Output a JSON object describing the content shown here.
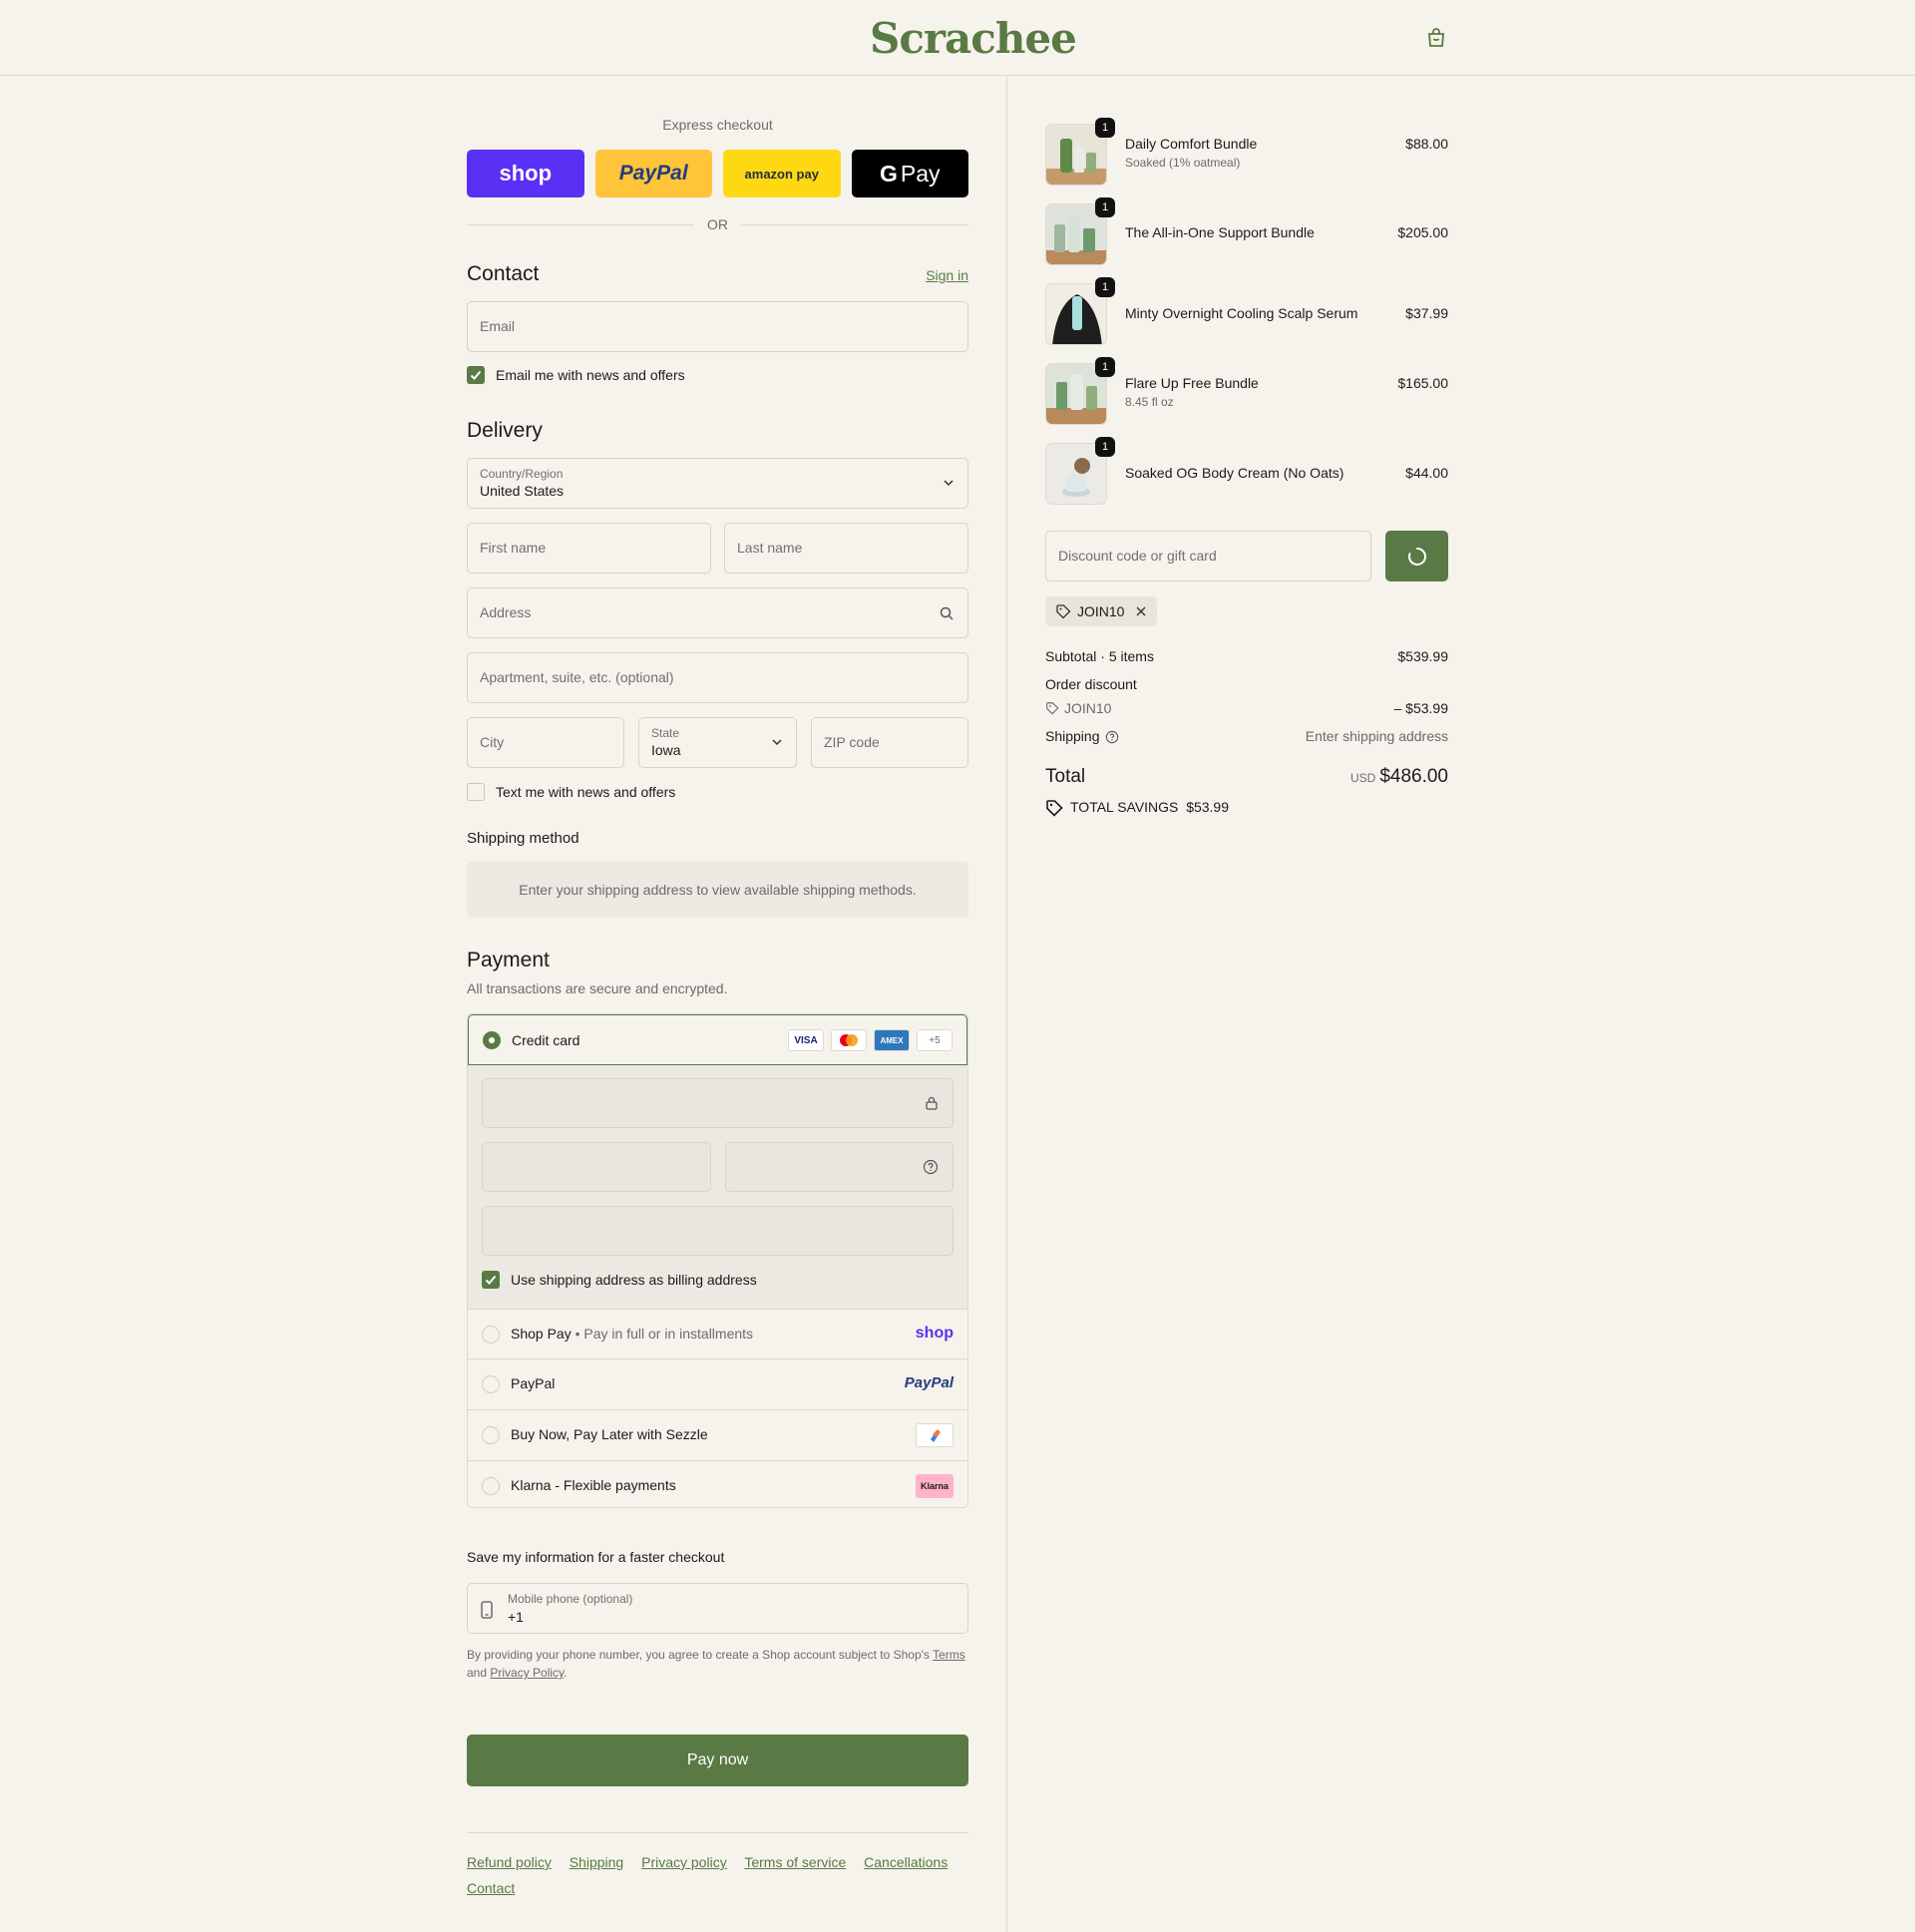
{
  "brand": {
    "logo_text": "Scrachee",
    "accent": "#5a7a45"
  },
  "header": {
    "cart_icon": "shopping-bag-icon"
  },
  "express": {
    "title": "Express checkout",
    "buttons": [
      "shop",
      "PayPal",
      "amazon pay",
      "Pay"
    ],
    "or": "OR"
  },
  "contact": {
    "title": "Contact",
    "sign_in": "Sign in",
    "email_placeholder": "Email",
    "news_label": "Email me with news and offers",
    "news_checked": true
  },
  "delivery": {
    "title": "Delivery",
    "country_label": "Country/Region",
    "country_value": "United States",
    "first_name": "First name",
    "last_name": "Last name",
    "address": "Address",
    "apartment": "Apartment, suite, etc. (optional)",
    "city": "City",
    "state_label": "State",
    "state_value": "Iowa",
    "zip": "ZIP code",
    "text_label": "Text me with news and offers",
    "text_checked": false
  },
  "shipping_method": {
    "title": "Shipping method",
    "message": "Enter your shipping address to view available shipping methods."
  },
  "payment": {
    "title": "Payment",
    "subtitle": "All transactions are secure and encrypted.",
    "credit_card": "Credit card",
    "card_logos": [
      "VISA",
      "MC",
      "AMEX",
      "+5"
    ],
    "billing_same": "Use shipping address as billing address",
    "options": [
      {
        "label": "Shop Pay",
        "sub": "Pay in full or in installments",
        "logo": "shop"
      },
      {
        "label": "PayPal",
        "sub": "",
        "logo": "PayPal"
      },
      {
        "label": "Buy Now, Pay Later with Sezzle",
        "sub": "",
        "logo": ""
      },
      {
        "label": "Klarna - Flexible payments",
        "sub": "",
        "logo": "Klarna"
      }
    ]
  },
  "save_info": {
    "title": "Save my information for a faster checkout",
    "phone_label": "Mobile phone (optional)",
    "phone_value": "+1",
    "legal_prefix": "By providing your phone number, you agree to create a Shop account subject to Shop's",
    "terms": "Terms",
    "and": "and",
    "privacy": "Privacy Policy",
    "period": "."
  },
  "pay_now": "Pay now",
  "footer": {
    "links": [
      "Refund policy",
      "Shipping",
      "Privacy policy",
      "Terms of service",
      "Cancellations",
      "Contact"
    ]
  },
  "cart": {
    "items": [
      {
        "name": "Daily Comfort Bundle",
        "sub": "Soaked (1% oatmeal)",
        "price": "$88.00",
        "qty": "1"
      },
      {
        "name": "The All-in-One Support Bundle",
        "sub": "",
        "price": "$205.00",
        "qty": "1"
      },
      {
        "name": "Minty Overnight Cooling Scalp Serum",
        "sub": "",
        "price": "$37.99",
        "qty": "1"
      },
      {
        "name": "Flare Up Free Bundle",
        "sub": "8.45 fl oz",
        "price": "$165.00",
        "qty": "1"
      },
      {
        "name": "Soaked OG Body Cream (No Oats)",
        "sub": "",
        "price": "$44.00",
        "qty": "1"
      }
    ],
    "discount_placeholder": "Discount code or gift card",
    "applied_code": "JOIN10",
    "subtotal_label": "Subtotal · 5 items",
    "subtotal": "$539.99",
    "order_discount_label": "Order discount",
    "discount_code": "JOIN10",
    "discount_amount": "– $53.99",
    "shipping_label": "Shipping",
    "shipping_value": "Enter shipping address",
    "total_label": "Total",
    "currency": "USD",
    "total": "$486.00",
    "savings_label": "TOTAL SAVINGS",
    "savings": "$53.99"
  }
}
